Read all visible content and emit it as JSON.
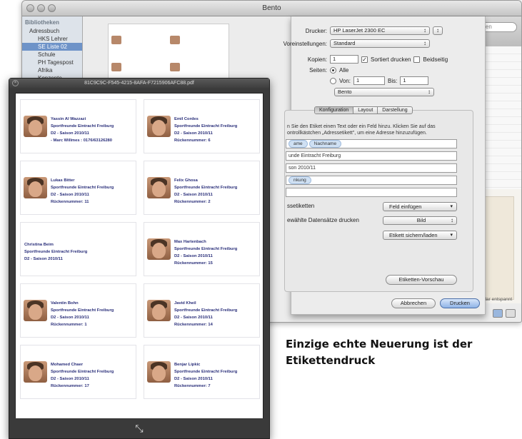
{
  "bento_window": {
    "title": "Bento",
    "library_header": "Bibliotheken",
    "library_items": [
      "Adressbuch",
      "HKS Lehrer",
      "SE Liste 02",
      "Schule",
      "PH Tagespost",
      "Afrika",
      "Konzepte"
    ],
    "search_placeholder": "suchen",
    "right_panel_label": "Formular entspannt"
  },
  "print_sheet": {
    "printer_label": "Drucker:",
    "printer_value": "HP LaserJet 2300 EC",
    "presets_label": "Voreinstellungen:",
    "presets_value": "Standard",
    "copies_label": "Kopien:",
    "copies_value": "1",
    "collated_label": "Sortiert drucken",
    "duplex_label": "Beidseitig",
    "pages_label": "Seiten:",
    "pages_all": "Alle",
    "pages_from": "Von:",
    "pages_from_value": "1",
    "pages_to": "Bis:",
    "pages_to_value": "1",
    "app_popup": "Bento",
    "tabs": [
      "Konfiguration",
      "Layout",
      "Darstellung"
    ],
    "hint": "n Sie den Etiket einen Text oder ein Feld hinzu. Klicken Sie auf das ontrollkästchen „Adressetikett\", um eine Adresse hinzuzufügen.",
    "token_1": "ame",
    "token_2": "Nachname",
    "field_2": "unde Eintracht Freiburg",
    "field_3": "son 2010/11",
    "token_4": "nkung",
    "address_label": "ssetiketten",
    "insert_field": "Feld einfügen",
    "selected_records": "ewählte Datensätze drucken",
    "image_popup": "Bild",
    "save_load": "Etikett sichern/laden",
    "preview_button": "Etiketten-Vorschau",
    "cancel_button": "Abbrechen",
    "print_button": "Drucken"
  },
  "pdf_window": {
    "title": "81C9C9C-F545-4215-8AFA-F7215906AFC88.pdf",
    "cards": [
      {
        "name": "Yassin Al Wazzazi",
        "team": "Sportfreunde Eintracht Freiburg",
        "season": "D2 - Saison 2010/11",
        "extra": "- Marc Willmes : 0176/63126280"
      },
      {
        "name": "Emil Cordes",
        "team": "Sportfreunde Eintracht Freiburg",
        "season": "D2 - Saison 2010/11",
        "extra": "Rückennummer: 6"
      },
      {
        "name": "Lukas Bitter",
        "team": "Sportfreunde Eintracht Freiburg",
        "season": "D2 - Saison 2010/11",
        "extra": "Rückennummer: 11"
      },
      {
        "name": "Felix Ghosa",
        "team": "Sportfreunde Eintracht Freiburg",
        "season": "D2 - Saison 2010/11",
        "extra": "Rückennummer: 2"
      },
      {
        "name": "Christina Beim",
        "team": "Sportfreunde Eintracht Freiburg",
        "season": "D2 - Saison 2010/11",
        "extra": ""
      },
      {
        "name": "Max Hartenbach",
        "team": "Sportfreunde Eintracht Freiburg",
        "season": "D2 - Saison 2010/11",
        "extra": "Rückennummer: 15"
      },
      {
        "name": "Valentin Bohn",
        "team": "Sportfreunde Eintracht Freiburg",
        "season": "D2 - Saison 2010/11",
        "extra": "Rückennummer: 1"
      },
      {
        "name": "Javid Kheil",
        "team": "Sportfreunde Eintracht Freiburg",
        "season": "D2 - Saison 2010/11",
        "extra": "Rückennummer: 14"
      },
      {
        "name": "Mohamed Chaer",
        "team": "Sportfreunde Eintracht Freiburg",
        "season": "D2 - Saison 2010/11",
        "extra": "Rückennummer: 17"
      },
      {
        "name": "Benjar Lipkic",
        "team": "Sportfreunde Eintracht Freiburg",
        "season": "D2 - Saison 2010/11",
        "extra": "Rückennummer: 7"
      }
    ],
    "resize_icon": "expand-arrows"
  },
  "caption": "Einzige echte Neuerung ist der Etikettendruck"
}
